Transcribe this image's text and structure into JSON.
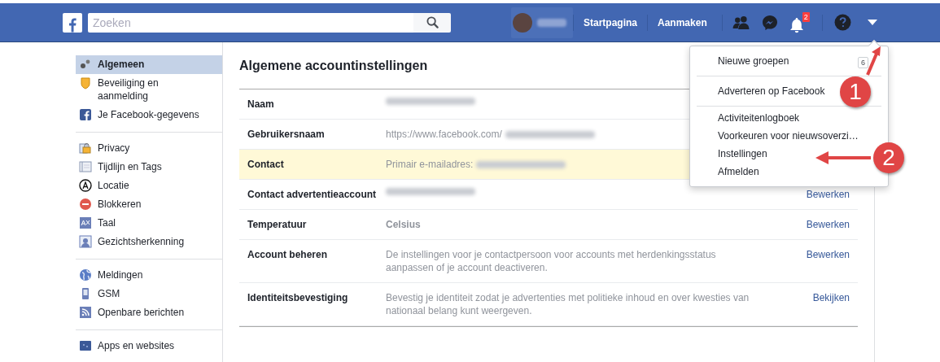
{
  "top_bar": {
    "search": {
      "placeholder": "Zoeken"
    },
    "nav_links": [
      "Startpagina",
      "Aanmaken"
    ],
    "notification_badge": "2"
  },
  "sidebar": {
    "groups": [
      [
        {
          "label": "Algemeen",
          "selected": true
        },
        {
          "label": "Beveiliging en aanmelding",
          "selected": false
        },
        {
          "label": "Je Facebook-gegevens",
          "selected": false
        }
      ],
      [
        {
          "label": "Privacy",
          "selected": false
        },
        {
          "label": "Tijdlijn en Tags",
          "selected": false
        },
        {
          "label": "Locatie",
          "selected": false
        },
        {
          "label": "Blokkeren",
          "selected": false
        },
        {
          "label": "Taal",
          "selected": false
        },
        {
          "label": "Gezichtsherkenning",
          "selected": false
        }
      ],
      [
        {
          "label": "Meldingen",
          "selected": false
        },
        {
          "label": "GSM",
          "selected": false
        },
        {
          "label": "Openbare berichten",
          "selected": false
        }
      ],
      [
        {
          "label": "Apps en websites",
          "selected": false
        }
      ]
    ]
  },
  "settings": {
    "title": "Algemene accountinstellingen",
    "rows": [
      {
        "label": "Naam",
        "value": "",
        "redacted": true,
        "highlighted": false,
        "action": ""
      },
      {
        "label": "Gebruikersnaam",
        "value": "https://www.facebook.com/",
        "redacted": true,
        "highlighted": false,
        "action": ""
      },
      {
        "label": "Contact",
        "value": "Primair e-mailadres:",
        "redacted": true,
        "highlighted": true,
        "action": ""
      },
      {
        "label": "Contact advertentieaccount",
        "value": "",
        "redacted": true,
        "highlighted": false,
        "action": "Bewerken"
      },
      {
        "label": "Temperatuur",
        "value": "Celsius",
        "redacted": false,
        "highlighted": false,
        "action": "Bewerken"
      },
      {
        "label": "Account beheren",
        "value": "De instellingen voor je contactpersoon voor accounts met herdenkingsstatus aanpassen of je account deactiveren.",
        "redacted": false,
        "highlighted": false,
        "action": "Bewerken"
      },
      {
        "label": "Identiteitsbevestiging",
        "value": "Bevestig je identiteit zodat je advertenties met politieke inhoud en over kwesties van nationaal belang kunt weergeven.",
        "redacted": false,
        "highlighted": false,
        "action": "Bekijken"
      }
    ]
  },
  "dropdown_menu": {
    "groups": [
      [
        {
          "label": "Nieuwe groepen",
          "badge": "6"
        }
      ],
      [
        {
          "label": "Adverteren op Facebook"
        }
      ],
      [
        {
          "label": "Activiteitenlogboek"
        },
        {
          "label": "Voorkeuren voor nieuwsoverzi…"
        },
        {
          "label": "Instellingen"
        },
        {
          "label": "Afmelden"
        }
      ]
    ]
  },
  "annotations": [
    {
      "number": "1"
    },
    {
      "number": "2"
    }
  ]
}
